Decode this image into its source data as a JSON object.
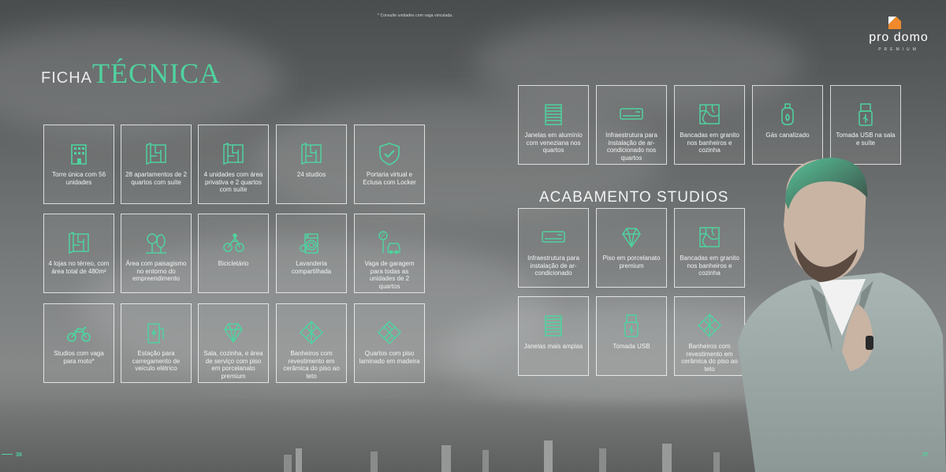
{
  "footnote": "* Consulte unidades com vaga vinculada.",
  "brand": {
    "name": "pro domo",
    "tagline": "PREMIUM"
  },
  "title": {
    "part1": "FICHA",
    "part2": "TÉCNICA"
  },
  "colors": {
    "accent": "#4fd3a0",
    "card_border": "#ffffff"
  },
  "ficha_tecnica": [
    {
      "icon": "building-icon",
      "label": "Torre única com 56 unidades"
    },
    {
      "icon": "floor-plan-icon",
      "label": "28 apartamentos de 2 quartos com suíte"
    },
    {
      "icon": "floor-plan-icon",
      "label": "4 unidades com área privativa e 2 quartos com suíte"
    },
    {
      "icon": "floor-plan-icon",
      "label": "24 studios"
    },
    {
      "icon": "shield-check-icon",
      "label": "Portaria virtual e Eclusa com Locker"
    },
    {
      "icon": "floor-plan-icon",
      "label": "4 lojas no térreo, com área total de 480m²"
    },
    {
      "icon": "trees-icon",
      "label": "Área com paisagismo no entorno do empreendimento"
    },
    {
      "icon": "cyclist-icon",
      "label": "Bicicletário"
    },
    {
      "icon": "washing-machine-icon",
      "label": "Lavanderia compartilhada"
    },
    {
      "icon": "parking-car-icon",
      "label": "Vaga de garagem para todas as unidades de 2 quartos"
    },
    {
      "icon": "motorcycle-icon",
      "label": "Studios com vaga para moto*"
    },
    {
      "icon": "ev-charger-icon",
      "label": "Estação para carregamento de veículo elétrico"
    },
    {
      "icon": "diamond-icon",
      "label": "Sala, cozinha, e área de serviço com piso em porcelanato premium"
    },
    {
      "icon": "wall-tiles-icon",
      "label": "Banheiros com revestimento em cerâmica do piso ao teto"
    },
    {
      "icon": "wood-floor-icon",
      "label": "Quartos com piso laminado em madeira"
    }
  ],
  "acabamento_apartamentos": [
    {
      "icon": "window-blinds-icon",
      "label": "Janelas em alumínio com veneziana nos quartos"
    },
    {
      "icon": "air-conditioner-icon",
      "label": "Infraestrutura para instalação de ar-condicionado nos quartos"
    },
    {
      "icon": "granite-icon",
      "label": "Bancadas em granito nos banheiros e cozinha"
    },
    {
      "icon": "gas-cylinder-icon",
      "label": "Gás canalizado"
    },
    {
      "icon": "usb-icon",
      "label": "Tomada USB na sala e suíte"
    }
  ],
  "acabamento_studios_title": "ACABAMENTO STUDIOS",
  "acabamento_studios": [
    {
      "icon": "air-conditioner-icon",
      "label": "Infraestrutura para instalação de ar-condicionado"
    },
    {
      "icon": "diamond-icon",
      "label": "Piso em porcelanato premium"
    },
    {
      "icon": "granite-icon",
      "label": "Bancadas em granito nos banheiros e cozinha"
    },
    {
      "icon": "window-blinds-icon",
      "label": "Janelas mais amplas"
    },
    {
      "icon": "usb-icon",
      "label": "Tomada USB"
    },
    {
      "icon": "wall-tiles-icon",
      "label": "Banheiros com revestimento em cerâmica do piso ao teto"
    }
  ],
  "page_left": "36",
  "page_right": "37"
}
